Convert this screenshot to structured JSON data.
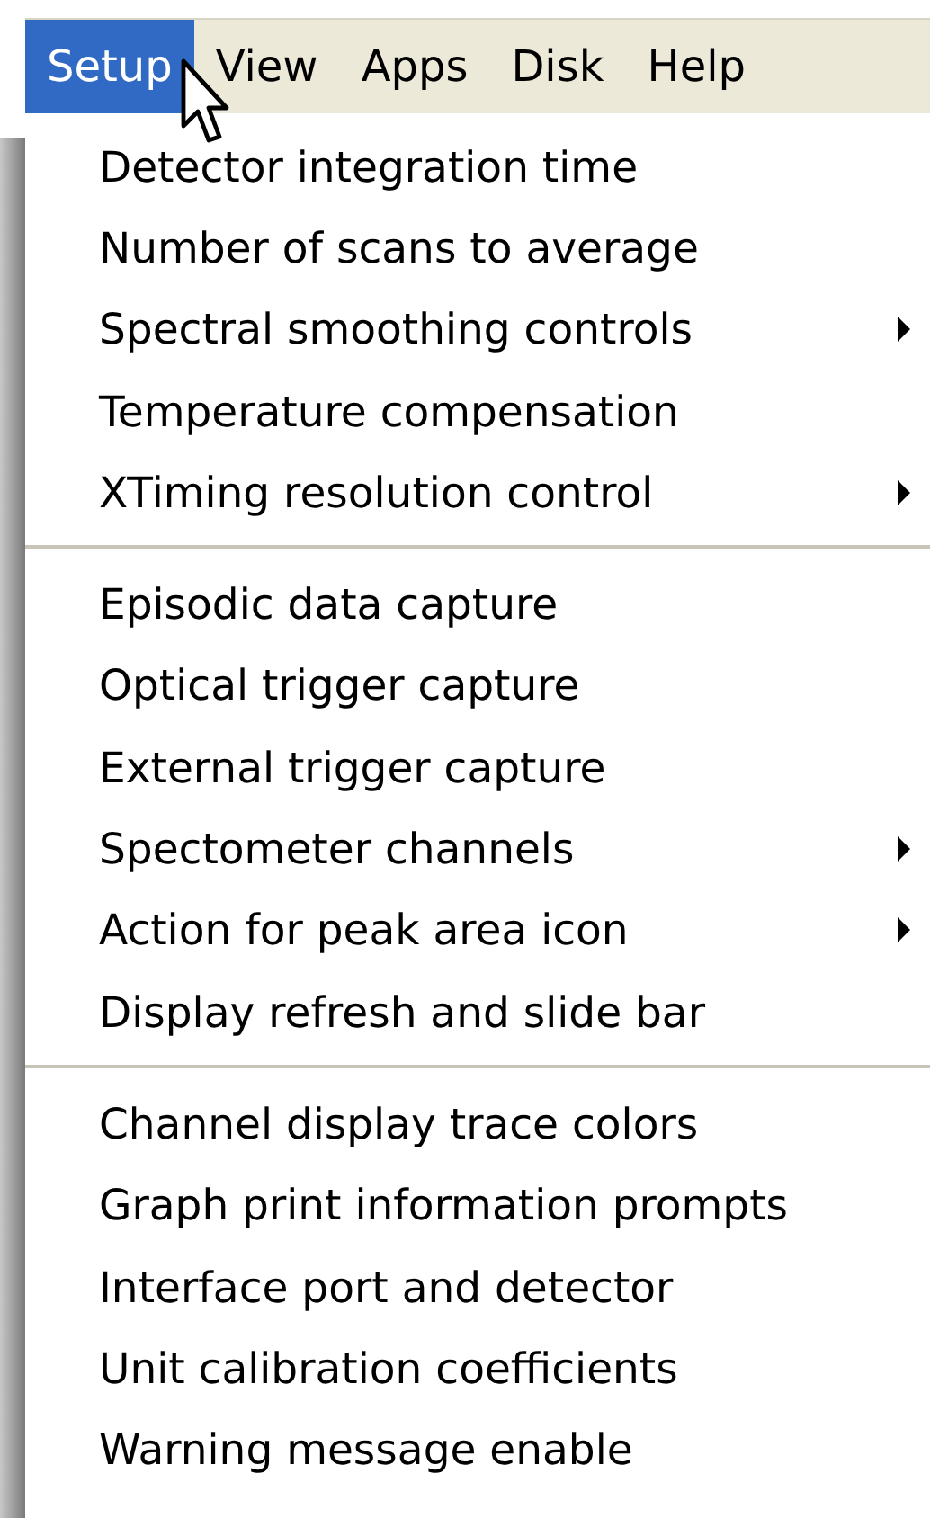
{
  "menubar": [
    {
      "label": "Setup",
      "selected": true
    },
    {
      "label": "View",
      "selected": false
    },
    {
      "label": "Apps",
      "selected": false
    },
    {
      "label": "Disk",
      "selected": false
    },
    {
      "label": "Help",
      "selected": false
    }
  ],
  "menu": {
    "groups": [
      {
        "items": [
          {
            "label": "Detector integration time",
            "submenu": false
          },
          {
            "label": "Number of scans to average",
            "submenu": false
          },
          {
            "label": "Spectral smoothing controls",
            "submenu": true
          },
          {
            "label": "Temperature compensation",
            "submenu": false
          },
          {
            "label": "XTiming resolution control",
            "submenu": true
          }
        ]
      },
      {
        "items": [
          {
            "label": "Episodic data capture",
            "submenu": false
          },
          {
            "label": "Optical trigger capture",
            "submenu": false
          },
          {
            "label": "External trigger capture",
            "submenu": false
          },
          {
            "label": "Spectometer channels",
            "submenu": true
          },
          {
            "label": "Action for peak area icon",
            "submenu": true
          },
          {
            "label": "Display refresh and slide bar",
            "submenu": false
          }
        ]
      },
      {
        "items": [
          {
            "label": "Channel display trace colors",
            "submenu": false
          },
          {
            "label": "Graph print information prompts",
            "submenu": false
          },
          {
            "label": "Interface port and detector",
            "submenu": false
          },
          {
            "label": "Unit calibration coefficients",
            "submenu": false
          },
          {
            "label": "Warning message enable",
            "submenu": false
          }
        ]
      }
    ]
  }
}
